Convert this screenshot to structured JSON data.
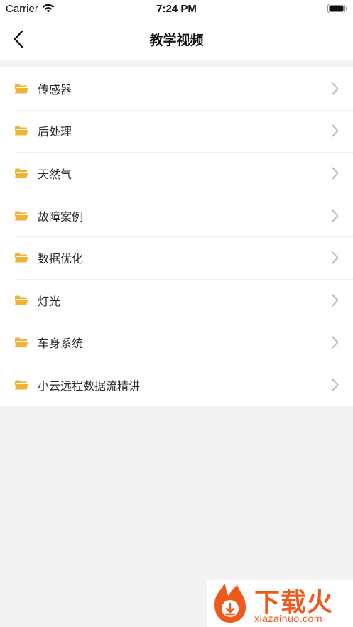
{
  "status_bar": {
    "carrier": "Carrier",
    "time": "7:24 PM"
  },
  "nav": {
    "title": "教学视频",
    "back_icon": "chevron-left-icon"
  },
  "list": {
    "icon": "folder-icon",
    "icon_color": "#f3b233",
    "items": [
      {
        "label": "传感器"
      },
      {
        "label": "后处理"
      },
      {
        "label": "天然气"
      },
      {
        "label": "故障案例"
      },
      {
        "label": "数据优化"
      },
      {
        "label": "灯光"
      },
      {
        "label": "车身系统"
      },
      {
        "label": "小云远程数据流精讲"
      }
    ]
  },
  "watermark": {
    "title": "下载火",
    "subtitle": "xiazaihuo.com",
    "color": "#ef5a1c"
  }
}
